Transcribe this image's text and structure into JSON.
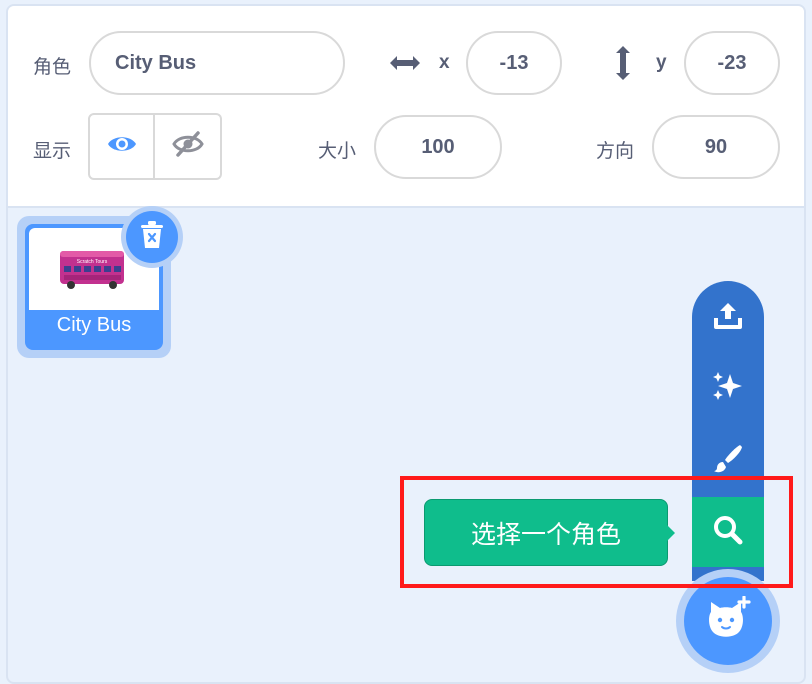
{
  "sprite_info": {
    "sprite_label": "角色",
    "sprite_name_value": "City Bus",
    "x_label": "x",
    "x_value": "-13",
    "y_label": "y",
    "y_value": "-23",
    "show_label": "显示",
    "size_label": "大小",
    "size_value": "100",
    "direction_label": "方向",
    "direction_value": "90"
  },
  "sprite_list": {
    "items": [
      {
        "name": "City Bus",
        "thumbnail_text": "Scratch Tours",
        "selected": true
      }
    ]
  },
  "add_sprite_menu": {
    "items": [
      {
        "icon": "upload-icon"
      },
      {
        "icon": "surprise-sparkle-icon"
      },
      {
        "icon": "paint-brush-icon"
      },
      {
        "icon": "search-icon",
        "active": true
      }
    ],
    "main_icon": "cat-plus-icon",
    "tooltip": "选择一个角色"
  },
  "colors": {
    "accent_blue": "#4c97ff",
    "menu_blue": "#3373cc",
    "active_green": "#0fbd8c",
    "annotation_red": "#ff1a1a",
    "background": "#e9f1fc"
  }
}
